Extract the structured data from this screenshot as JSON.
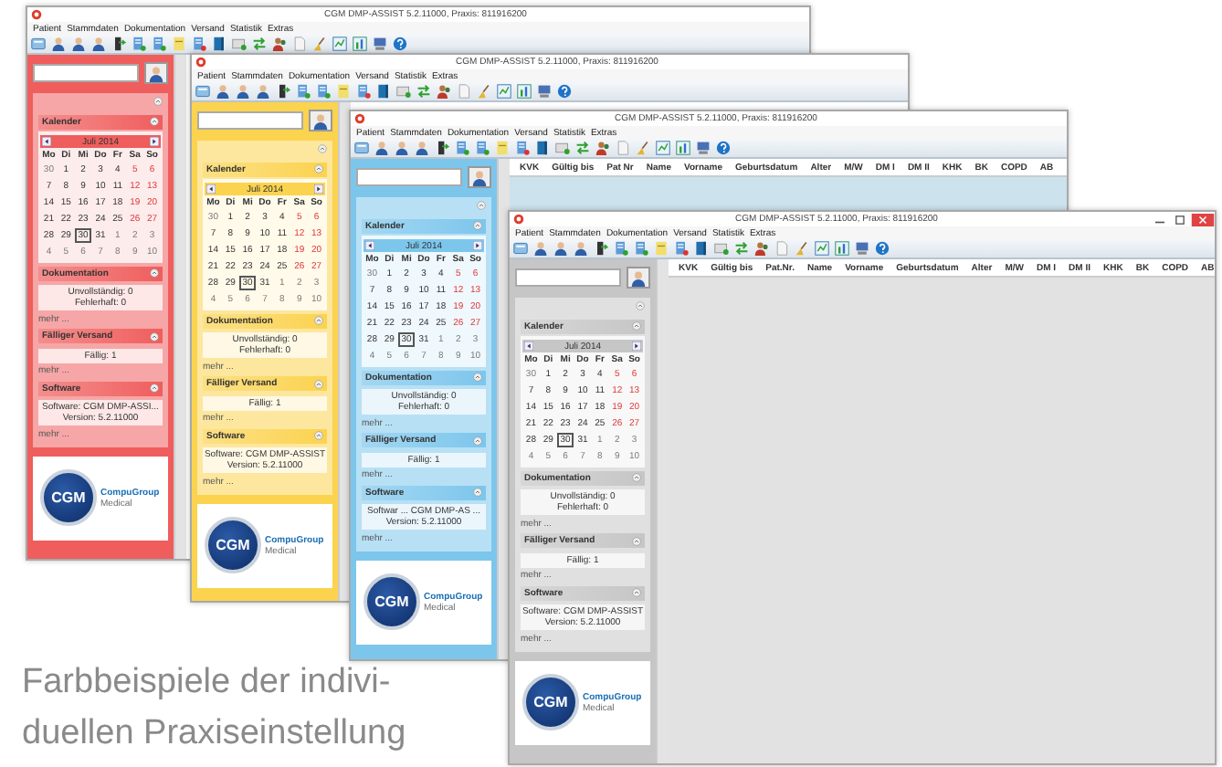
{
  "windows": [
    {
      "title": "CGM DMP-ASSIST 5.2.11000, Praxis: 811916200",
      "color": "#ef5d5d",
      "controls": false,
      "menu": [
        "Patient",
        "Stammdaten",
        "Dokumentation",
        "Versand",
        "Statistik",
        "Extras"
      ],
      "calendar": {
        "heading": "Kalender",
        "month": "Juli 2014",
        "weekdays": [
          "Mo",
          "Di",
          "Mi",
          "Do",
          "Fr",
          "Sa",
          "So"
        ],
        "weeks": [
          [
            {
              "day": "30",
              "outside": true,
              "selected": false
            },
            {
              "day": "1",
              "outside": false,
              "selected": false
            },
            {
              "day": "2",
              "outside": false,
              "selected": false
            },
            {
              "day": "3",
              "outside": false,
              "selected": false
            },
            {
              "day": "4",
              "outside": false,
              "selected": false
            },
            {
              "day": "5",
              "outside": false,
              "selected": false
            },
            {
              "day": "6",
              "outside": false,
              "selected": false
            }
          ],
          [
            {
              "day": "7",
              "outside": false,
              "selected": false
            },
            {
              "day": "8",
              "outside": false,
              "selected": false
            },
            {
              "day": "9",
              "outside": false,
              "selected": false
            },
            {
              "day": "10",
              "outside": false,
              "selected": false
            },
            {
              "day": "11",
              "outside": false,
              "selected": false
            },
            {
              "day": "12",
              "outside": false,
              "selected": false
            },
            {
              "day": "13",
              "outside": false,
              "selected": false
            }
          ],
          [
            {
              "day": "14",
              "outside": false,
              "selected": false
            },
            {
              "day": "15",
              "outside": false,
              "selected": false
            },
            {
              "day": "16",
              "outside": false,
              "selected": false
            },
            {
              "day": "17",
              "outside": false,
              "selected": false
            },
            {
              "day": "18",
              "outside": false,
              "selected": false
            },
            {
              "day": "19",
              "outside": false,
              "selected": false
            },
            {
              "day": "20",
              "outside": false,
              "selected": false
            }
          ],
          [
            {
              "day": "21",
              "outside": false,
              "selected": false
            },
            {
              "day": "22",
              "outside": false,
              "selected": false
            },
            {
              "day": "23",
              "outside": false,
              "selected": false
            },
            {
              "day": "24",
              "outside": false,
              "selected": false
            },
            {
              "day": "25",
              "outside": false,
              "selected": false
            },
            {
              "day": "26",
              "outside": false,
              "selected": false
            },
            {
              "day": "27",
              "outside": false,
              "selected": false
            }
          ],
          [
            {
              "day": "28",
              "outside": false,
              "selected": false
            },
            {
              "day": "29",
              "outside": false,
              "selected": false
            },
            {
              "day": "30",
              "outside": false,
              "selected": true
            },
            {
              "day": "31",
              "outside": false,
              "selected": false
            },
            {
              "day": "1",
              "outside": true,
              "selected": false
            },
            {
              "day": "2",
              "outside": true,
              "selected": false
            },
            {
              "day": "3",
              "outside": true,
              "selected": false
            }
          ],
          [
            {
              "day": "4",
              "outside": true,
              "selected": false
            },
            {
              "day": "5",
              "outside": true,
              "selected": false
            },
            {
              "day": "6",
              "outside": true,
              "selected": false
            },
            {
              "day": "7",
              "outside": true,
              "selected": false
            },
            {
              "day": "8",
              "outside": true,
              "selected": false
            },
            {
              "day": "9",
              "outside": true,
              "selected": false
            },
            {
              "day": "10",
              "outside": true,
              "selected": false
            }
          ]
        ]
      },
      "sections": [
        {
          "heading": "Dokumentation",
          "lines": [
            "Unvollständig: 0",
            "Fehlerhaft: 0"
          ],
          "more": "mehr ..."
        },
        {
          "heading": "Fälliger Versand",
          "lines": [
            "Fällig: 1"
          ],
          "more": "mehr ..."
        },
        {
          "heading": "Software",
          "lines": [
            "Software: CGM DMP-ASSI...",
            "Version: 5.2.11000"
          ],
          "more": "mehr ..."
        }
      ],
      "logo": {
        "mark": "CGM",
        "name": "CompuGroup",
        "sub": "Medical"
      }
    },
    {
      "title": "CGM DMP-ASSIST 5.2.11000, Praxis: 811916200",
      "color": "#fbd34e",
      "controls": false,
      "menu": [
        "Patient",
        "Stammdaten",
        "Dokumentation",
        "Versand",
        "Statistik",
        "Extras"
      ],
      "calendar": {
        "heading": "Kalender",
        "month": "Juli 2014",
        "weekdays": [
          "Mo",
          "Di",
          "Mi",
          "Do",
          "Fr",
          "Sa",
          "So"
        ],
        "weeks": [
          [
            {
              "day": "30",
              "outside": true,
              "selected": false
            },
            {
              "day": "1",
              "outside": false,
              "selected": false
            },
            {
              "day": "2",
              "outside": false,
              "selected": false
            },
            {
              "day": "3",
              "outside": false,
              "selected": false
            },
            {
              "day": "4",
              "outside": false,
              "selected": false
            },
            {
              "day": "5",
              "outside": false,
              "selected": false
            },
            {
              "day": "6",
              "outside": false,
              "selected": false
            }
          ],
          [
            {
              "day": "7",
              "outside": false,
              "selected": false
            },
            {
              "day": "8",
              "outside": false,
              "selected": false
            },
            {
              "day": "9",
              "outside": false,
              "selected": false
            },
            {
              "day": "10",
              "outside": false,
              "selected": false
            },
            {
              "day": "11",
              "outside": false,
              "selected": false
            },
            {
              "day": "12",
              "outside": false,
              "selected": false
            },
            {
              "day": "13",
              "outside": false,
              "selected": false
            }
          ],
          [
            {
              "day": "14",
              "outside": false,
              "selected": false
            },
            {
              "day": "15",
              "outside": false,
              "selected": false
            },
            {
              "day": "16",
              "outside": false,
              "selected": false
            },
            {
              "day": "17",
              "outside": false,
              "selected": false
            },
            {
              "day": "18",
              "outside": false,
              "selected": false
            },
            {
              "day": "19",
              "outside": false,
              "selected": false
            },
            {
              "day": "20",
              "outside": false,
              "selected": false
            }
          ],
          [
            {
              "day": "21",
              "outside": false,
              "selected": false
            },
            {
              "day": "22",
              "outside": false,
              "selected": false
            },
            {
              "day": "23",
              "outside": false,
              "selected": false
            },
            {
              "day": "24",
              "outside": false,
              "selected": false
            },
            {
              "day": "25",
              "outside": false,
              "selected": false
            },
            {
              "day": "26",
              "outside": false,
              "selected": false
            },
            {
              "day": "27",
              "outside": false,
              "selected": false
            }
          ],
          [
            {
              "day": "28",
              "outside": false,
              "selected": false
            },
            {
              "day": "29",
              "outside": false,
              "selected": false
            },
            {
              "day": "30",
              "outside": false,
              "selected": true
            },
            {
              "day": "31",
              "outside": false,
              "selected": false
            },
            {
              "day": "1",
              "outside": true,
              "selected": false
            },
            {
              "day": "2",
              "outside": true,
              "selected": false
            },
            {
              "day": "3",
              "outside": true,
              "selected": false
            }
          ],
          [
            {
              "day": "4",
              "outside": true,
              "selected": false
            },
            {
              "day": "5",
              "outside": true,
              "selected": false
            },
            {
              "day": "6",
              "outside": true,
              "selected": false
            },
            {
              "day": "7",
              "outside": true,
              "selected": false
            },
            {
              "day": "8",
              "outside": true,
              "selected": false
            },
            {
              "day": "9",
              "outside": true,
              "selected": false
            },
            {
              "day": "10",
              "outside": true,
              "selected": false
            }
          ]
        ]
      },
      "sections": [
        {
          "heading": "Dokumentation",
          "lines": [
            "Unvollständig: 0",
            "Fehlerhaft: 0"
          ],
          "more": "mehr ..."
        },
        {
          "heading": "Fälliger Versand",
          "lines": [
            "Fällig: 1"
          ],
          "more": "mehr ..."
        },
        {
          "heading": "Software",
          "lines": [
            "Software: CGM DMP-ASSIST",
            "Version: 5.2.11000"
          ],
          "more": "mehr ..."
        }
      ],
      "logo": {
        "mark": "CGM",
        "name": "CompuGroup",
        "sub": "Medical"
      }
    },
    {
      "title": "CGM DMP-ASSIST 5.2.11000, Praxis: 811916200",
      "color": "#7cc6ec",
      "controls": false,
      "menu": [
        "Patient",
        "Stammdaten",
        "Dokumentation",
        "Versand",
        "Statistik",
        "Extras"
      ],
      "calendar": {
        "heading": "Kalender",
        "month": "Juli 2014",
        "weekdays": [
          "Mo",
          "Di",
          "Mi",
          "Do",
          "Fr",
          "Sa",
          "So"
        ],
        "weeks": [
          [
            {
              "day": "30",
              "outside": true,
              "selected": false
            },
            {
              "day": "1",
              "outside": false,
              "selected": false
            },
            {
              "day": "2",
              "outside": false,
              "selected": false
            },
            {
              "day": "3",
              "outside": false,
              "selected": false
            },
            {
              "day": "4",
              "outside": false,
              "selected": false
            },
            {
              "day": "5",
              "outside": false,
              "selected": false
            },
            {
              "day": "6",
              "outside": false,
              "selected": false
            }
          ],
          [
            {
              "day": "7",
              "outside": false,
              "selected": false
            },
            {
              "day": "8",
              "outside": false,
              "selected": false
            },
            {
              "day": "9",
              "outside": false,
              "selected": false
            },
            {
              "day": "10",
              "outside": false,
              "selected": false
            },
            {
              "day": "11",
              "outside": false,
              "selected": false
            },
            {
              "day": "12",
              "outside": false,
              "selected": false
            },
            {
              "day": "13",
              "outside": false,
              "selected": false
            }
          ],
          [
            {
              "day": "14",
              "outside": false,
              "selected": false
            },
            {
              "day": "15",
              "outside": false,
              "selected": false
            },
            {
              "day": "16",
              "outside": false,
              "selected": false
            },
            {
              "day": "17",
              "outside": false,
              "selected": false
            },
            {
              "day": "18",
              "outside": false,
              "selected": false
            },
            {
              "day": "19",
              "outside": false,
              "selected": false
            },
            {
              "day": "20",
              "outside": false,
              "selected": false
            }
          ],
          [
            {
              "day": "21",
              "outside": false,
              "selected": false
            },
            {
              "day": "22",
              "outside": false,
              "selected": false
            },
            {
              "day": "23",
              "outside": false,
              "selected": false
            },
            {
              "day": "24",
              "outside": false,
              "selected": false
            },
            {
              "day": "25",
              "outside": false,
              "selected": false
            },
            {
              "day": "26",
              "outside": false,
              "selected": false
            },
            {
              "day": "27",
              "outside": false,
              "selected": false
            }
          ],
          [
            {
              "day": "28",
              "outside": false,
              "selected": false
            },
            {
              "day": "29",
              "outside": false,
              "selected": false
            },
            {
              "day": "30",
              "outside": false,
              "selected": true
            },
            {
              "day": "31",
              "outside": false,
              "selected": false
            },
            {
              "day": "1",
              "outside": true,
              "selected": false
            },
            {
              "day": "2",
              "outside": true,
              "selected": false
            },
            {
              "day": "3",
              "outside": true,
              "selected": false
            }
          ],
          [
            {
              "day": "4",
              "outside": true,
              "selected": false
            },
            {
              "day": "5",
              "outside": true,
              "selected": false
            },
            {
              "day": "6",
              "outside": true,
              "selected": false
            },
            {
              "day": "7",
              "outside": true,
              "selected": false
            },
            {
              "day": "8",
              "outside": true,
              "selected": false
            },
            {
              "day": "9",
              "outside": true,
              "selected": false
            },
            {
              "day": "10",
              "outside": true,
              "selected": false
            }
          ]
        ]
      },
      "sections": [
        {
          "heading": "Dokumentation",
          "lines": [
            "Unvollständig: 0",
            "Fehlerhaft: 0"
          ],
          "more": "mehr ..."
        },
        {
          "heading": "Fälliger Versand",
          "lines": [
            "Fällig: 1"
          ],
          "more": "mehr ..."
        },
        {
          "heading": "Software",
          "lines": [
            "Softwar ... CGM DMP-AS ...",
            "Version: 5.2.11000"
          ],
          "more": "mehr ..."
        }
      ],
      "logo": {
        "mark": "CGM",
        "name": "CompuGroup",
        "sub": "Medical"
      },
      "columns": [
        "KVK",
        "Gültig bis",
        "Pat Nr",
        "Name",
        "Vorname",
        "Geburtsdatum",
        "Alter",
        "M/W",
        "DM I",
        "DM II",
        "KHK",
        "BK",
        "COPD",
        "AB"
      ]
    },
    {
      "title": "CGM DMP-ASSIST 5.2.11000, Praxis: 811916200",
      "color": "#c6c6c6",
      "controls": true,
      "menu": [
        "Patient",
        "Stammdaten",
        "Dokumentation",
        "Versand",
        "Statistik",
        "Extras"
      ],
      "calendar": {
        "heading": "Kalender",
        "month": "Juli 2014",
        "weekdays": [
          "Mo",
          "Di",
          "Mi",
          "Do",
          "Fr",
          "Sa",
          "So"
        ],
        "weeks": [
          [
            {
              "day": "30",
              "outside": true,
              "selected": false
            },
            {
              "day": "1",
              "outside": false,
              "selected": false
            },
            {
              "day": "2",
              "outside": false,
              "selected": false
            },
            {
              "day": "3",
              "outside": false,
              "selected": false
            },
            {
              "day": "4",
              "outside": false,
              "selected": false
            },
            {
              "day": "5",
              "outside": false,
              "selected": false
            },
            {
              "day": "6",
              "outside": false,
              "selected": false
            }
          ],
          [
            {
              "day": "7",
              "outside": false,
              "selected": false
            },
            {
              "day": "8",
              "outside": false,
              "selected": false
            },
            {
              "day": "9",
              "outside": false,
              "selected": false
            },
            {
              "day": "10",
              "outside": false,
              "selected": false
            },
            {
              "day": "11",
              "outside": false,
              "selected": false
            },
            {
              "day": "12",
              "outside": false,
              "selected": false
            },
            {
              "day": "13",
              "outside": false,
              "selected": false
            }
          ],
          [
            {
              "day": "14",
              "outside": false,
              "selected": false
            },
            {
              "day": "15",
              "outside": false,
              "selected": false
            },
            {
              "day": "16",
              "outside": false,
              "selected": false
            },
            {
              "day": "17",
              "outside": false,
              "selected": false
            },
            {
              "day": "18",
              "outside": false,
              "selected": false
            },
            {
              "day": "19",
              "outside": false,
              "selected": false
            },
            {
              "day": "20",
              "outside": false,
              "selected": false
            }
          ],
          [
            {
              "day": "21",
              "outside": false,
              "selected": false
            },
            {
              "day": "22",
              "outside": false,
              "selected": false
            },
            {
              "day": "23",
              "outside": false,
              "selected": false
            },
            {
              "day": "24",
              "outside": false,
              "selected": false
            },
            {
              "day": "25",
              "outside": false,
              "selected": false
            },
            {
              "day": "26",
              "outside": false,
              "selected": false
            },
            {
              "day": "27",
              "outside": false,
              "selected": false
            }
          ],
          [
            {
              "day": "28",
              "outside": false,
              "selected": false
            },
            {
              "day": "29",
              "outside": false,
              "selected": false
            },
            {
              "day": "30",
              "outside": false,
              "selected": true
            },
            {
              "day": "31",
              "outside": false,
              "selected": false
            },
            {
              "day": "1",
              "outside": true,
              "selected": false
            },
            {
              "day": "2",
              "outside": true,
              "selected": false
            },
            {
              "day": "3",
              "outside": true,
              "selected": false
            }
          ],
          [
            {
              "day": "4",
              "outside": true,
              "selected": false
            },
            {
              "day": "5",
              "outside": true,
              "selected": false
            },
            {
              "day": "6",
              "outside": true,
              "selected": false
            },
            {
              "day": "7",
              "outside": true,
              "selected": false
            },
            {
              "day": "8",
              "outside": true,
              "selected": false
            },
            {
              "day": "9",
              "outside": true,
              "selected": false
            },
            {
              "day": "10",
              "outside": true,
              "selected": false
            }
          ]
        ]
      },
      "sections": [
        {
          "heading": "Dokumentation",
          "lines": [
            "Unvollständig: 0",
            "Fehlerhaft: 0"
          ],
          "more": "mehr ..."
        },
        {
          "heading": "Fälliger Versand",
          "lines": [
            "Fällig: 1"
          ],
          "more": "mehr ..."
        },
        {
          "heading": "Software",
          "lines": [
            "Software: CGM DMP-ASSIST",
            "Version: 5.2.11000"
          ],
          "more": "mehr ..."
        }
      ],
      "logo": {
        "mark": "CGM",
        "name": "CompuGroup",
        "sub": "Medical"
      },
      "columns": [
        "KVK",
        "Gültig bis",
        "Pat.Nr.",
        "Name",
        "Vorname",
        "Geburtsdatum",
        "Alter",
        "M/W",
        "DM I",
        "DM II",
        "KHK",
        "BK",
        "COPD",
        "AB"
      ]
    }
  ],
  "caption": [
    "Farbbeispiele der indivi-",
    "duellen Praxiseinstellung"
  ]
}
